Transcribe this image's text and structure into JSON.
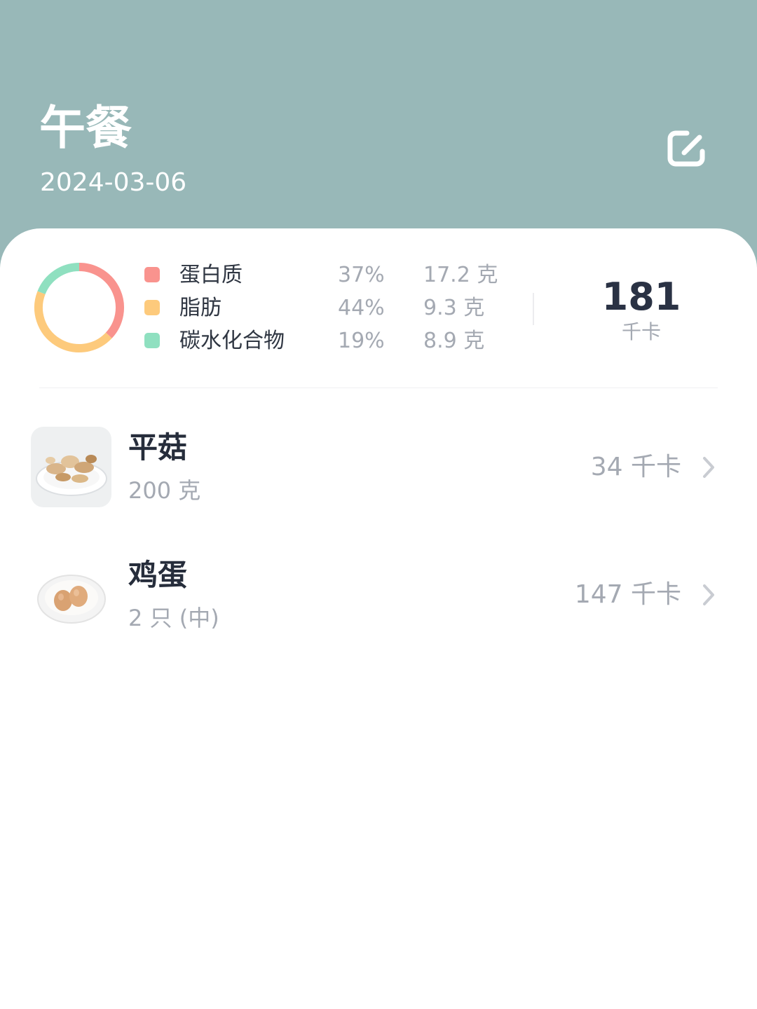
{
  "header": {
    "title": "午餐",
    "date": "2024-03-06",
    "edit_icon": "edit-icon",
    "background_color": "#98b8b8"
  },
  "summary": {
    "macros": [
      {
        "name": "蛋白质",
        "percent": "37%",
        "grams": "17.2 克",
        "color": "#f9938e"
      },
      {
        "name": "脂肪",
        "percent": "44%",
        "grams": "9.3 克",
        "color": "#fdca7c"
      },
      {
        "name": "碳水化合物",
        "percent": "19%",
        "grams": "8.9 克",
        "color": "#8fe0c0"
      }
    ],
    "donut_shares": [
      0.37,
      0.44,
      0.19
    ],
    "total_kcal": "181",
    "total_unit": "千卡"
  },
  "foods": [
    {
      "name": "平菇",
      "amount": "200 克",
      "kcal": "34 千卡",
      "thumb_icon": "oyster-mushroom-photo",
      "chevron_icon": "chevron-right-icon"
    },
    {
      "name": "鸡蛋",
      "amount": "2 只 (中)",
      "kcal": "147 千卡",
      "thumb_icon": "eggs-photo",
      "chevron_icon": "chevron-right-icon"
    }
  ]
}
